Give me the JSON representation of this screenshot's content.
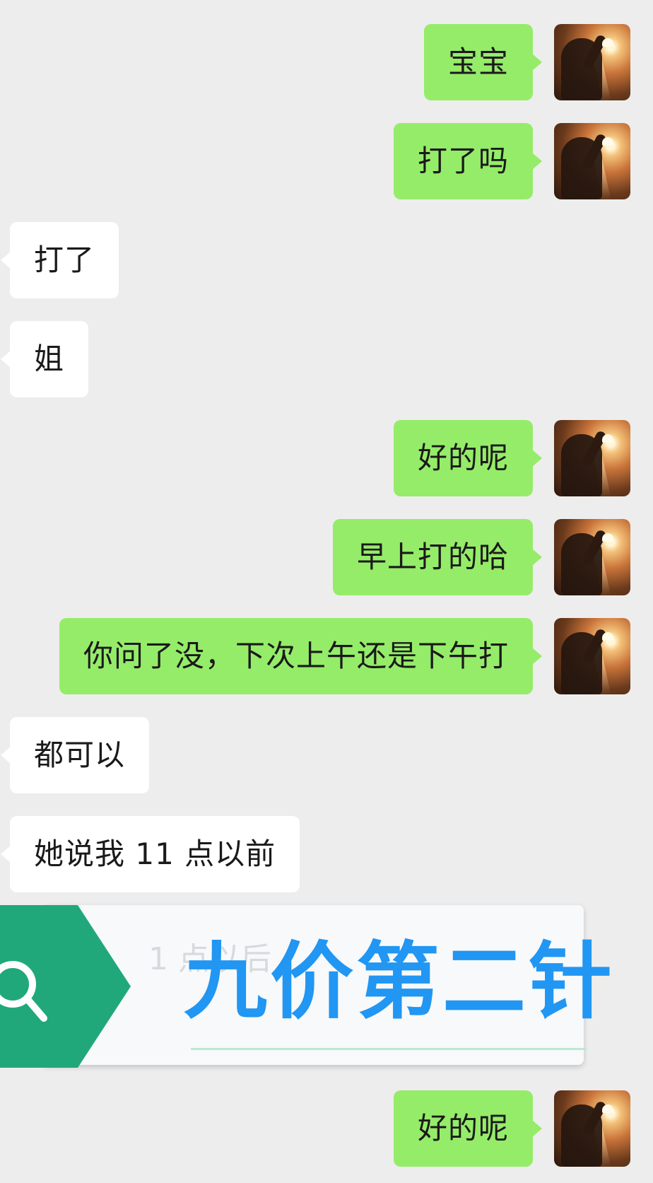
{
  "chat": {
    "messages": [
      {
        "side": "out",
        "text": "宝宝"
      },
      {
        "side": "out",
        "text": "打了吗"
      },
      {
        "side": "in",
        "text": "打了"
      },
      {
        "side": "in",
        "text": "姐"
      },
      {
        "side": "out",
        "text": "好的呢"
      },
      {
        "side": "out",
        "text": "早上打的哈"
      },
      {
        "side": "out",
        "text": "你问了没，下次上午还是下午打"
      },
      {
        "side": "in",
        "text": "都可以"
      },
      {
        "side": "in",
        "text": "她说我 11 点以前"
      },
      {
        "side": "out",
        "text": "好的呢"
      }
    ]
  },
  "banner": {
    "title": "九价第二针",
    "hidden_text": "1 点以后",
    "icon": "search-icon",
    "tag_color": "#21a87a",
    "title_color": "#2196f3"
  },
  "colors": {
    "background": "#ededed",
    "outgoing_bubble": "#95ec69",
    "incoming_bubble": "#ffffff"
  }
}
